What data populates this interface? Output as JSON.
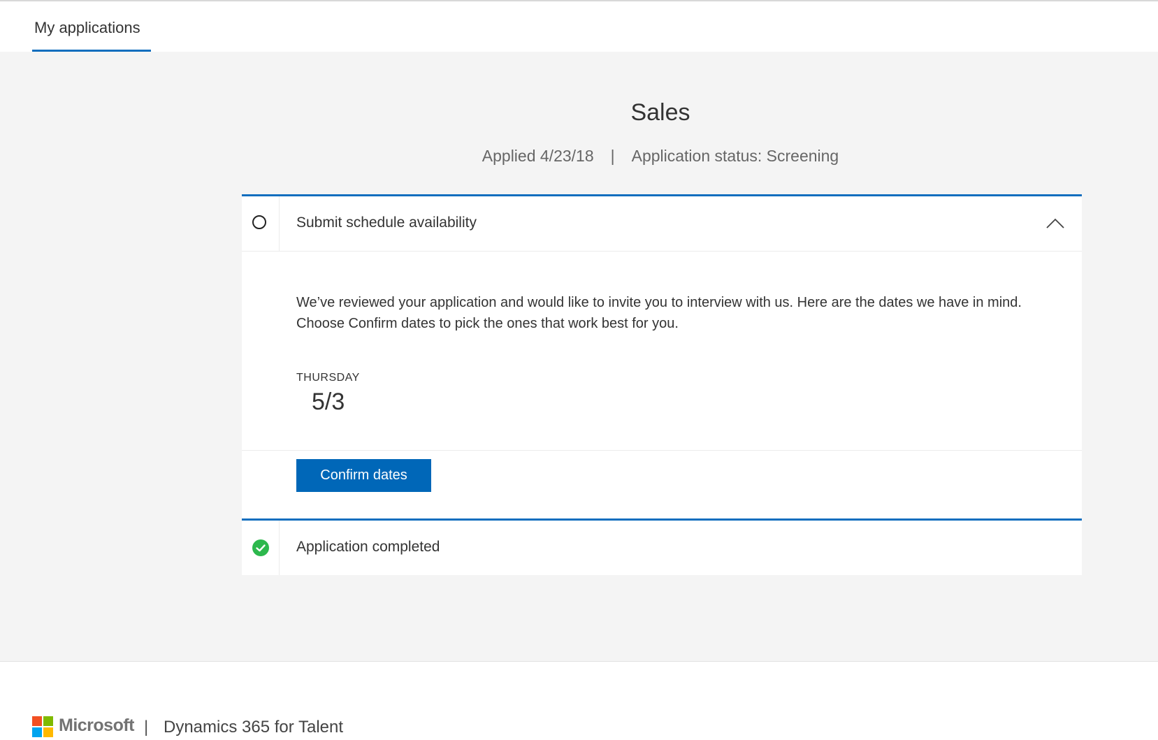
{
  "nav": {
    "tabs": [
      {
        "label": "My applications",
        "active": true
      }
    ]
  },
  "job": {
    "title": "Sales",
    "applied": "Applied 4/23/18",
    "separator": "|",
    "status": "Application status: Screening"
  },
  "steps": [
    {
      "title": "Submit schedule availability",
      "status": "pending",
      "status_icon": "empty-circle-icon",
      "expanded": true,
      "collapse_icon": "chevron-up-icon",
      "body_text": "We’ve reviewed your application and would like to invite you to interview with us. Here are the dates we have in mind. Choose Confirm dates to pick the ones that work best for you.",
      "dates": [
        {
          "day": "THURSDAY",
          "date": "5/3"
        }
      ],
      "action_label": "Confirm dates"
    },
    {
      "title": "Application completed",
      "status": "completed",
      "status_icon": "green-check-circle-icon"
    }
  ],
  "footer": {
    "brand": "Microsoft",
    "separator": "|",
    "product": "Dynamics 365 for Talent",
    "logo_colors": [
      "#f25022",
      "#7fba00",
      "#00a4ef",
      "#ffb900"
    ]
  },
  "colors": {
    "accent": "#106ebe",
    "button": "#0067b8",
    "success": "#2db84d",
    "page_background": "#f4f4f4"
  }
}
